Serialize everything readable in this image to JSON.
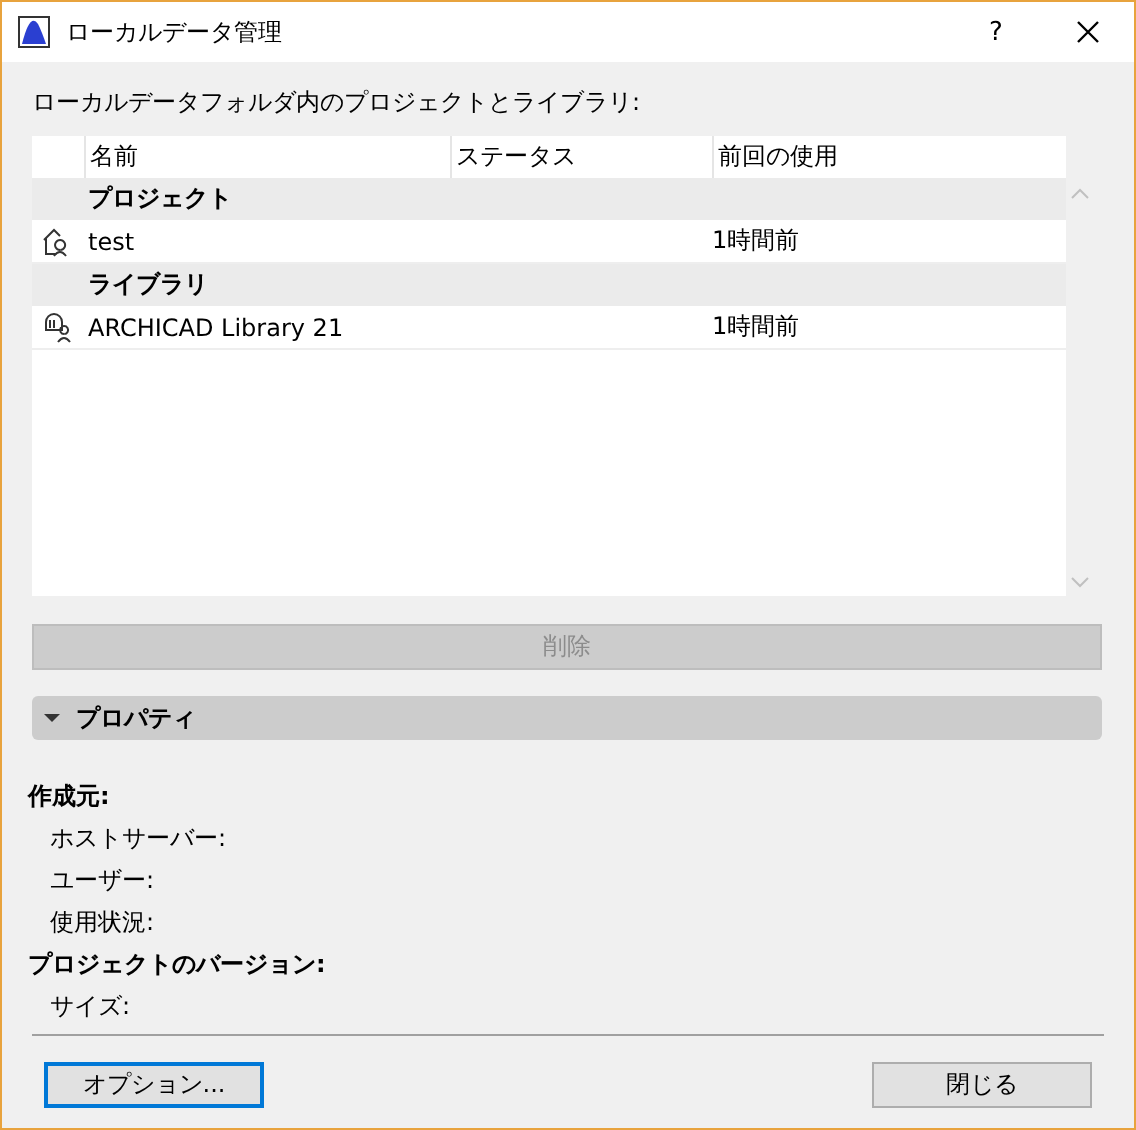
{
  "window": {
    "title": "ローカルデータ管理",
    "help": "?"
  },
  "list_title": "ローカルデータフォルダ内のプロジェクトとライブラリ:",
  "table": {
    "columns": [
      "名前",
      "ステータス",
      "前回の使用"
    ],
    "groups": [
      {
        "label": "プロジェクト",
        "rows": [
          {
            "kind": "project",
            "name": "test",
            "last_used": "1時間前"
          }
        ]
      },
      {
        "label": "ライブラリ",
        "rows": [
          {
            "kind": "library",
            "name": "ARCHICAD Library 21",
            "last_used": "1時間前"
          }
        ]
      }
    ]
  },
  "delete_button": {
    "label": "削除",
    "disabled": true
  },
  "properties": {
    "label": "プロパティ",
    "expanded": true,
    "items": [
      {
        "kind": "heading",
        "label": "作成元:"
      },
      {
        "kind": "field",
        "label": "ホストサーバー:"
      },
      {
        "kind": "field",
        "label": "ユーザー:"
      },
      {
        "kind": "field",
        "label": "使用状況:"
      },
      {
        "kind": "heading",
        "label": "プロジェクトのバージョン:"
      },
      {
        "kind": "field",
        "label": "サイズ:"
      }
    ]
  },
  "buttons": [
    {
      "label": "オプション...",
      "focused": true
    },
    {
      "label": "閉じる",
      "focused": false
    }
  ]
}
